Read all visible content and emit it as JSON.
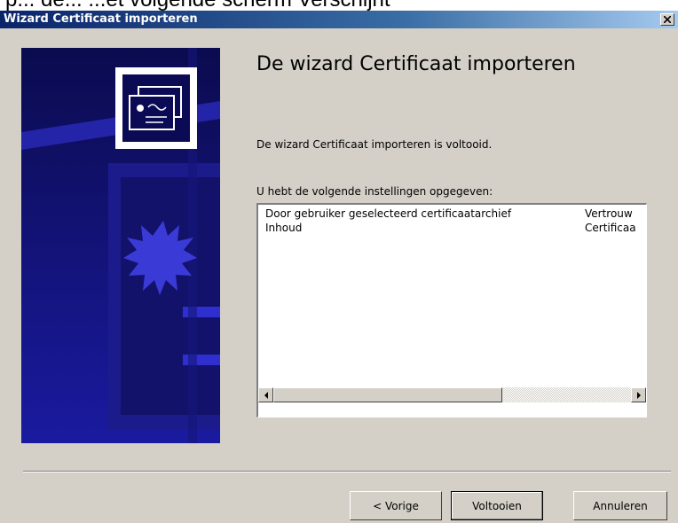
{
  "cropped_caption": "p... de... ...et volgende scherm Verschijnt",
  "window": {
    "title": "Wizard Certificaat importeren"
  },
  "heading": "De wizard Certificaat importeren",
  "status_text": "De wizard Certificaat importeren is voltooid.",
  "settings_label": "U hebt de volgende instellingen opgegeven:",
  "settings_rows": [
    {
      "name": "Door gebruiker geselecteerd certificaatarchief",
      "value": "Vertrouw"
    },
    {
      "name": "Inhoud",
      "value": "Certificaa"
    }
  ],
  "buttons": {
    "back": "< Vorige",
    "finish": "Voltooien",
    "cancel": "Annuleren"
  },
  "icons": {
    "close": "close-icon",
    "certificate": "certificate-icon",
    "scroll_left": "arrow-left-icon",
    "scroll_right": "arrow-right-icon"
  },
  "colors": {
    "titlebar_start": "#0a246a",
    "titlebar_end": "#a6caf0",
    "dialog_bg": "#d4d0c8",
    "art_bg": "#0b0b55"
  }
}
